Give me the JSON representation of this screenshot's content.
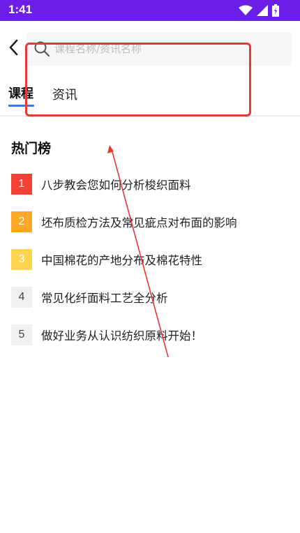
{
  "status_bar": {
    "time": "1:41",
    "icons": [
      "wifi-icon",
      "signal-icon",
      "battery-icon"
    ],
    "color": "#6b1fe6"
  },
  "search": {
    "placeholder": "课程名称/资讯名称",
    "value": ""
  },
  "tabs": [
    {
      "label": "课程",
      "active": true
    },
    {
      "label": "资讯",
      "active": false
    }
  ],
  "hot_list": {
    "title": "热门榜",
    "items": [
      {
        "rank": "1",
        "title": "八步教会您如何分析梭织面料"
      },
      {
        "rank": "2",
        "title": "坯布质检方法及常见疵点对布面的影响"
      },
      {
        "rank": "3",
        "title": "中国棉花的产地分布及棉花特性"
      },
      {
        "rank": "4",
        "title": "常见化纤面料工艺全分析"
      },
      {
        "rank": "5",
        "title": "做好业务从认识纺织原料开始！"
      }
    ]
  },
  "colors": {
    "accent": "#2e7de8",
    "annotation": "#e53935",
    "rank1": "#f44336",
    "rank2": "#ffa726",
    "rank3": "#ffd54f"
  }
}
